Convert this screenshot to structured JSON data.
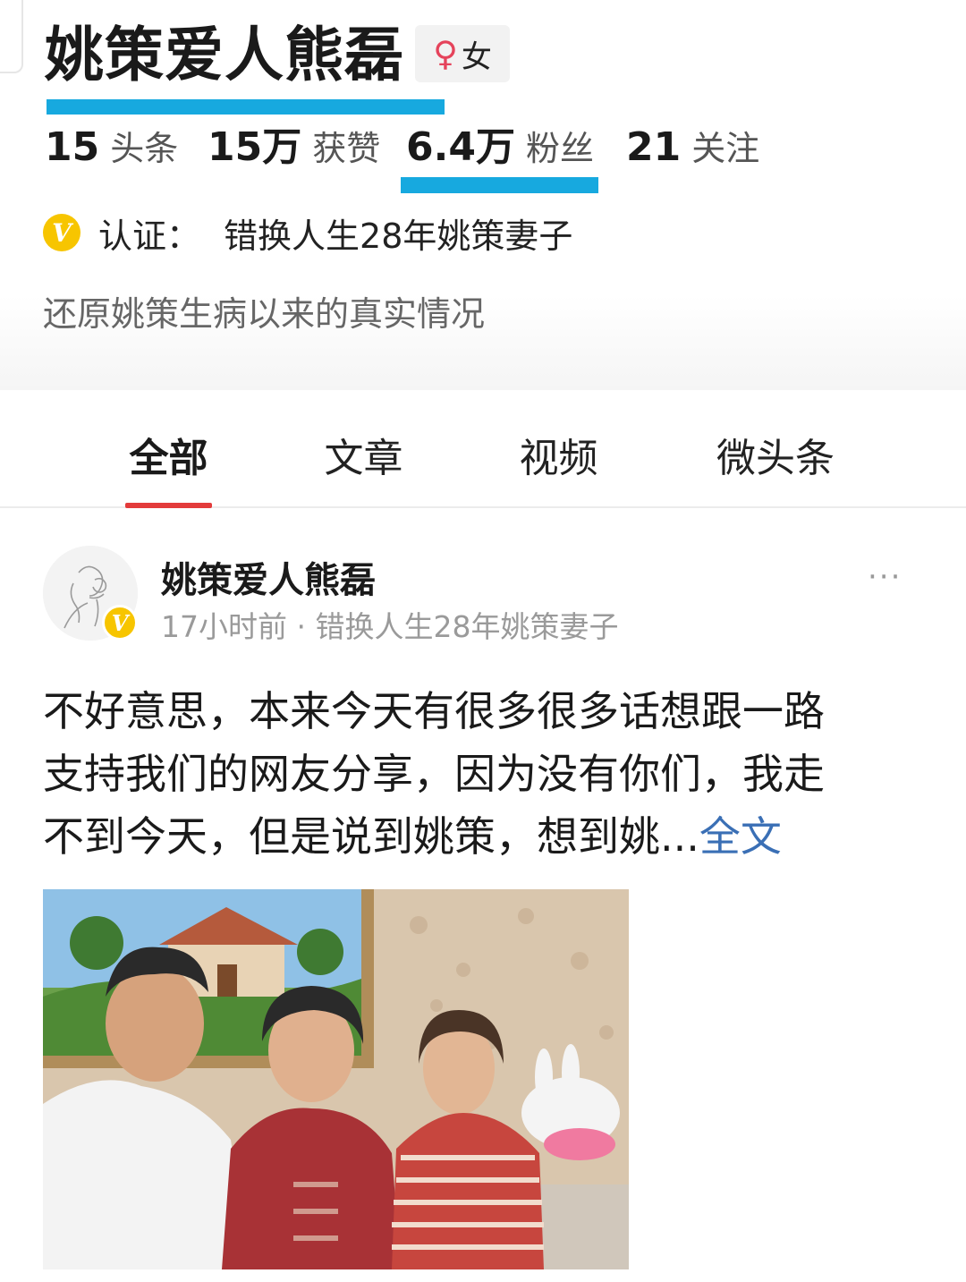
{
  "profile": {
    "name": "姚策爱人熊磊",
    "gender_icon": "♀",
    "gender": "女",
    "stats": [
      {
        "num": "15",
        "label": "头条"
      },
      {
        "num": "15万",
        "label": "获赞"
      },
      {
        "num": "6.4万",
        "label": "粉丝"
      },
      {
        "num": "21",
        "label": "关注"
      }
    ],
    "verify_badge": "V",
    "verify_label": "认证：",
    "verify_value": "错换人生28年姚策妻子",
    "bio": "还原姚策生病以来的真实情况"
  },
  "tabs": [
    {
      "label": "全部",
      "active": true
    },
    {
      "label": "文章",
      "active": false
    },
    {
      "label": "视频",
      "active": false
    },
    {
      "label": "微头条",
      "active": false
    }
  ],
  "post": {
    "author": "姚策爱人熊磊",
    "avatar_badge": "V",
    "meta": "17小时前 · 错换人生28年姚策妻子",
    "more_icon": "···",
    "text_lines": [
      "不好意思，本来今天有很多很多话想跟一路",
      "支持我们的网友分享，因为没有你们，我走",
      "不到今天，但是说到姚策，想到姚..."
    ],
    "read_more": "全文"
  },
  "colors": {
    "highlight": "#17a9df",
    "tab_underline": "#e33b3b",
    "link": "#3a6fb5",
    "verify_badge": "#f7c500",
    "female": "#e5435b"
  }
}
